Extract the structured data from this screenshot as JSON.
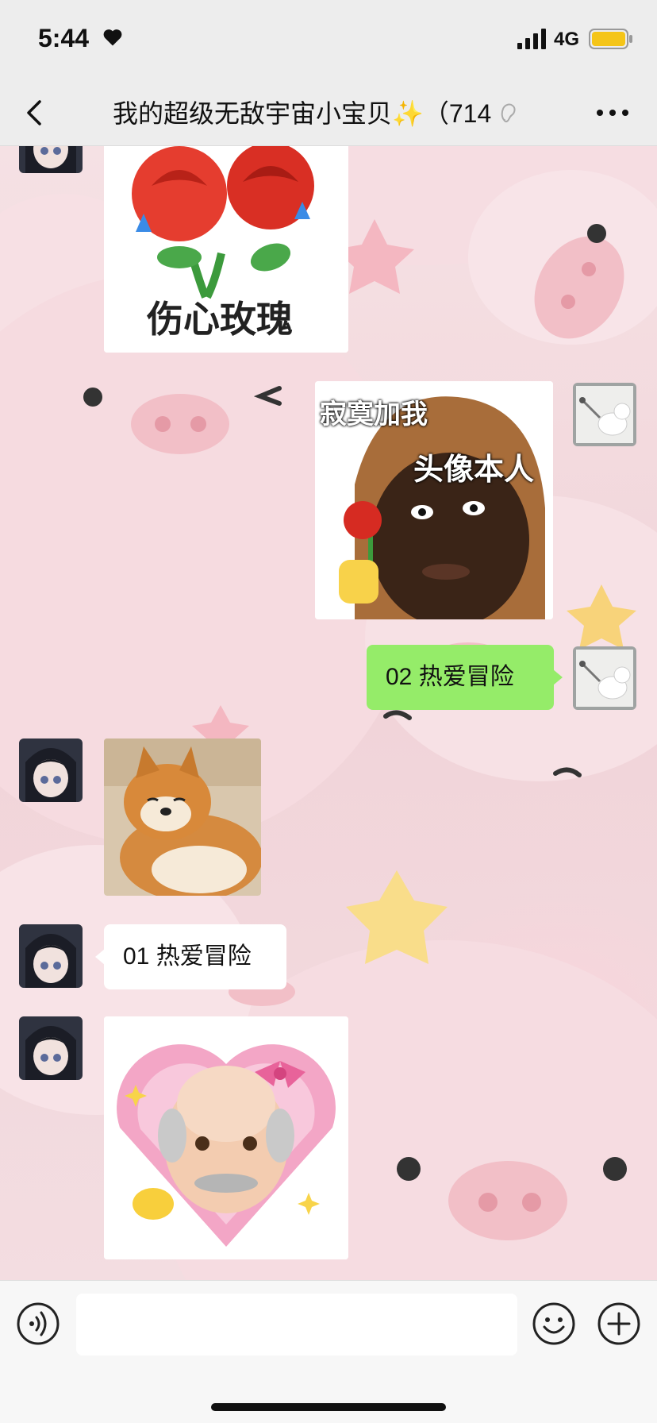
{
  "status_bar": {
    "time": "5:44",
    "network": "4G",
    "heart_icon": "heart-icon",
    "signal_icon": "signal-icon",
    "battery_icon": "battery-icon",
    "battery_color": "#f5c518"
  },
  "nav": {
    "title": "我的超级无敌宇宙小宝贝✨（714",
    "back_icon": "chevron-left-icon",
    "mute_icon": "ear-icon",
    "more_icon": "more-icon"
  },
  "messages": [
    {
      "side": "left",
      "type": "sticker",
      "caption": "伤心玫瑰"
    },
    {
      "side": "right",
      "type": "sticker",
      "caption_top": "寂寞加我",
      "caption_bottom": "头像本人"
    },
    {
      "side": "right",
      "type": "text",
      "text": "02 热爱冒险"
    },
    {
      "side": "left",
      "type": "sticker",
      "caption": ""
    },
    {
      "side": "left",
      "type": "text",
      "text": "01 热爱冒险"
    },
    {
      "side": "left",
      "type": "sticker",
      "caption": ""
    }
  ],
  "input_bar": {
    "placeholder": "",
    "voice_icon": "voice-icon",
    "emoji_icon": "smiley-icon",
    "plus_icon": "plus-icon"
  },
  "colors": {
    "bubble_green": "#95ec69",
    "bubble_white": "#ffffff",
    "bar_gray": "#ededed",
    "background_pink": "#f3dfe2"
  }
}
